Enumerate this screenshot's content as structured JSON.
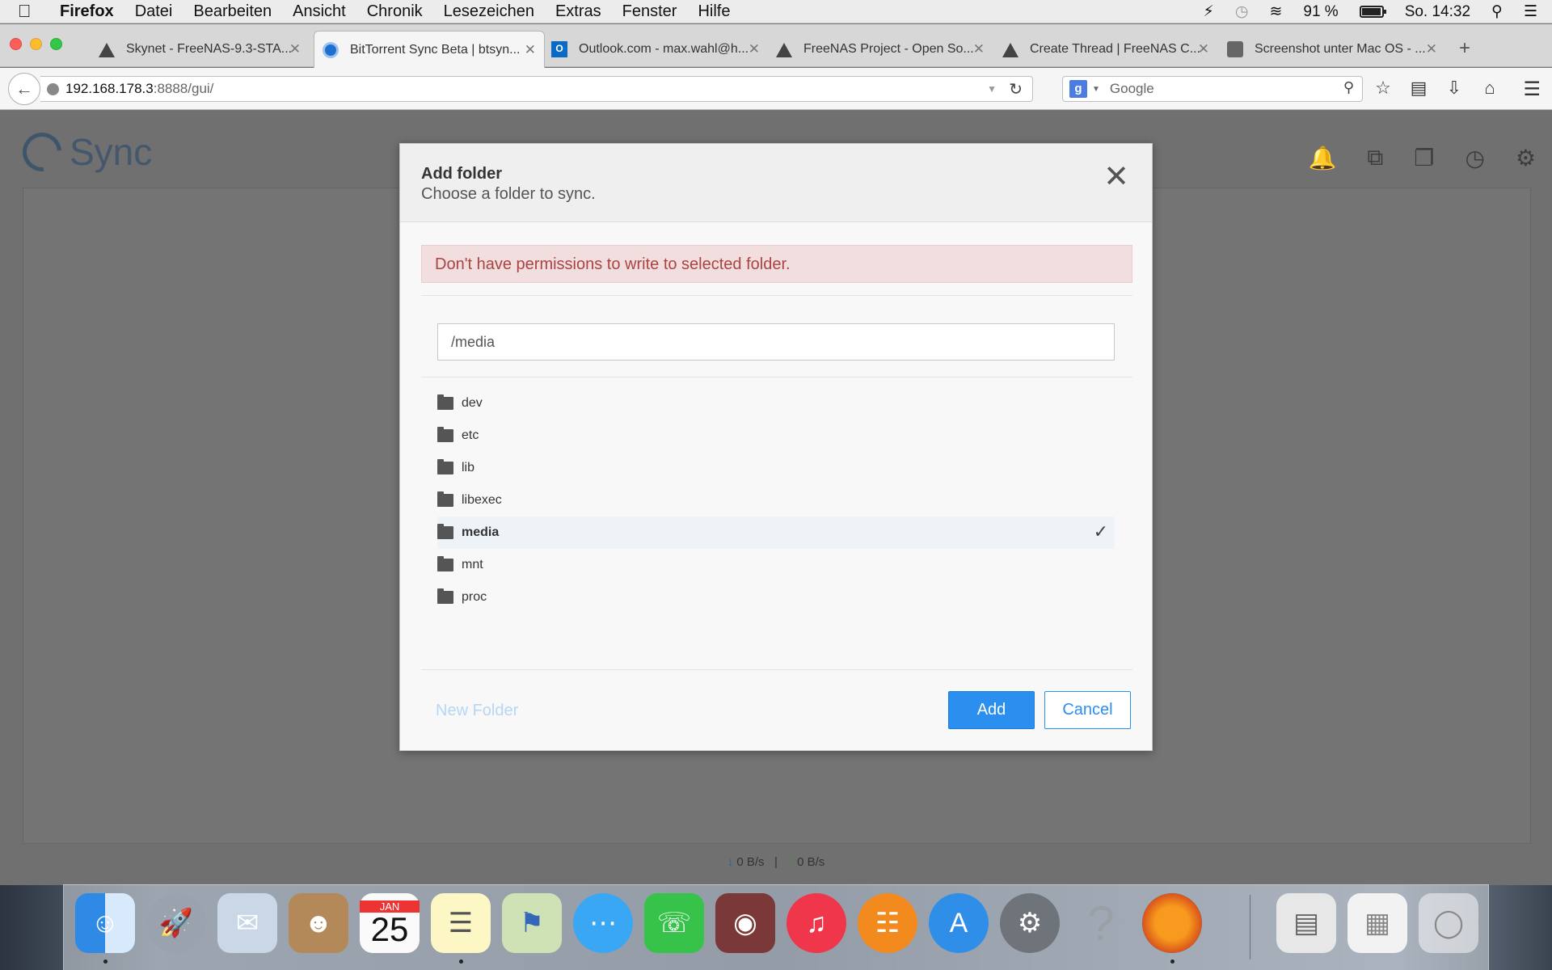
{
  "menubar": {
    "app": "Firefox",
    "items": [
      "Datei",
      "Bearbeiten",
      "Ansicht",
      "Chronik",
      "Lesezeichen",
      "Extras",
      "Fenster",
      "Hilfe"
    ],
    "battery": "91 %",
    "clock": "So. 14:32"
  },
  "tabs": [
    {
      "title": "Skynet - FreeNAS-9.3-STA...",
      "icon": "freenas-icon"
    },
    {
      "title": "BitTorrent Sync Beta | btsyn...",
      "icon": "sync-icon"
    },
    {
      "title": "Outlook.com - max.wahl@h...",
      "icon": "outlook-icon"
    },
    {
      "title": "FreeNAS Project - Open So...",
      "icon": "freenas-icon"
    },
    {
      "title": "Create Thread | FreeNAS C...",
      "icon": "freenas-icon"
    },
    {
      "title": "Screenshot unter Mac OS - ...",
      "icon": "puzzle-icon"
    }
  ],
  "navbar": {
    "url_host": "192.168.178.3",
    "url_path": ":8888/gui/",
    "search_placeholder": "Google"
  },
  "app": {
    "logo_text": "Sync",
    "status_down": "0 B/s",
    "status_up": "0 B/s"
  },
  "modal": {
    "title": "Add folder",
    "subtitle": "Choose a folder to sync.",
    "error": "Don't have permissions to write to selected folder.",
    "path": "/media",
    "folders": [
      "dev",
      "etc",
      "lib",
      "libexec",
      "media",
      "mnt",
      "proc"
    ],
    "selected": "media",
    "new_folder": "New Folder",
    "add": "Add",
    "cancel": "Cancel"
  },
  "dock": {
    "calendar_month": "JAN",
    "calendar_day": "25"
  }
}
